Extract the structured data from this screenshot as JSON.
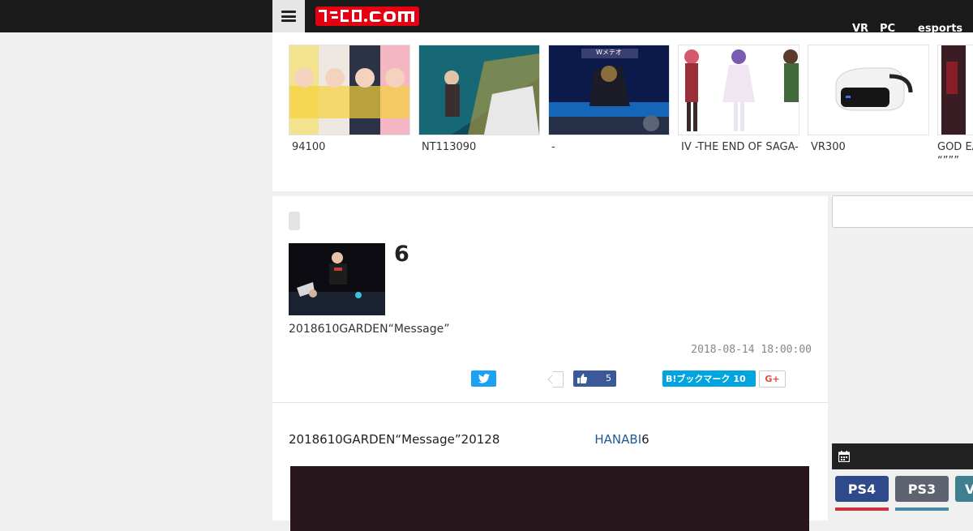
{
  "header": {
    "nav": [
      "VR",
      "PC",
      "esports"
    ]
  },
  "carousel": {
    "items": [
      {
        "caption": "94100"
      },
      {
        "caption": "NT113090"
      },
      {
        "caption": "-",
        "overlay": "Wメテオ"
      },
      {
        "caption": " IV -THE END OF SAGA-"
      },
      {
        "caption": "VR300"
      },
      {
        "caption": "GOD EA\n“”””"
      }
    ]
  },
  "article": {
    "title": "6",
    "lead": "2018610GARDEN“Message”",
    "date": "2018-08-14 18:00:00",
    "share": {
      "like_count": "5",
      "hatena_label": "B!ブックマーク",
      "hatena_count": "10",
      "gplus_label": "G+"
    },
    "body_pre": "2018610GARDEN“Message”20128",
    "body_link": "HANABI",
    "body_post": "6"
  },
  "sidebar": {
    "platforms": [
      "PS4",
      "PS3",
      "V"
    ]
  },
  "colors": {
    "topbar": "#1a1a1a",
    "twitter": "#1da1f2",
    "facebook": "#3b5998",
    "hatena": "#00a4de",
    "ps4": "#2f4a8a",
    "ps3": "#5d6470",
    "vita": "#3f7f8f"
  }
}
